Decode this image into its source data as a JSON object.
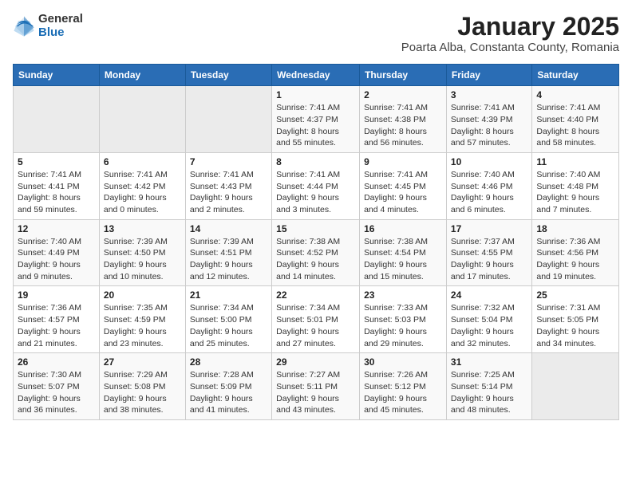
{
  "logo": {
    "general": "General",
    "blue": "Blue"
  },
  "title": "January 2025",
  "subtitle": "Poarta Alba, Constanta County, Romania",
  "headers": [
    "Sunday",
    "Monday",
    "Tuesday",
    "Wednesday",
    "Thursday",
    "Friday",
    "Saturday"
  ],
  "weeks": [
    [
      {
        "day": "",
        "sunrise": "",
        "sunset": "",
        "daylight": ""
      },
      {
        "day": "",
        "sunrise": "",
        "sunset": "",
        "daylight": ""
      },
      {
        "day": "",
        "sunrise": "",
        "sunset": "",
        "daylight": ""
      },
      {
        "day": "1",
        "sunrise": "Sunrise: 7:41 AM",
        "sunset": "Sunset: 4:37 PM",
        "daylight": "Daylight: 8 hours and 55 minutes."
      },
      {
        "day": "2",
        "sunrise": "Sunrise: 7:41 AM",
        "sunset": "Sunset: 4:38 PM",
        "daylight": "Daylight: 8 hours and 56 minutes."
      },
      {
        "day": "3",
        "sunrise": "Sunrise: 7:41 AM",
        "sunset": "Sunset: 4:39 PM",
        "daylight": "Daylight: 8 hours and 57 minutes."
      },
      {
        "day": "4",
        "sunrise": "Sunrise: 7:41 AM",
        "sunset": "Sunset: 4:40 PM",
        "daylight": "Daylight: 8 hours and 58 minutes."
      }
    ],
    [
      {
        "day": "5",
        "sunrise": "Sunrise: 7:41 AM",
        "sunset": "Sunset: 4:41 PM",
        "daylight": "Daylight: 8 hours and 59 minutes."
      },
      {
        "day": "6",
        "sunrise": "Sunrise: 7:41 AM",
        "sunset": "Sunset: 4:42 PM",
        "daylight": "Daylight: 9 hours and 0 minutes."
      },
      {
        "day": "7",
        "sunrise": "Sunrise: 7:41 AM",
        "sunset": "Sunset: 4:43 PM",
        "daylight": "Daylight: 9 hours and 2 minutes."
      },
      {
        "day": "8",
        "sunrise": "Sunrise: 7:41 AM",
        "sunset": "Sunset: 4:44 PM",
        "daylight": "Daylight: 9 hours and 3 minutes."
      },
      {
        "day": "9",
        "sunrise": "Sunrise: 7:41 AM",
        "sunset": "Sunset: 4:45 PM",
        "daylight": "Daylight: 9 hours and 4 minutes."
      },
      {
        "day": "10",
        "sunrise": "Sunrise: 7:40 AM",
        "sunset": "Sunset: 4:46 PM",
        "daylight": "Daylight: 9 hours and 6 minutes."
      },
      {
        "day": "11",
        "sunrise": "Sunrise: 7:40 AM",
        "sunset": "Sunset: 4:48 PM",
        "daylight": "Daylight: 9 hours and 7 minutes."
      }
    ],
    [
      {
        "day": "12",
        "sunrise": "Sunrise: 7:40 AM",
        "sunset": "Sunset: 4:49 PM",
        "daylight": "Daylight: 9 hours and 9 minutes."
      },
      {
        "day": "13",
        "sunrise": "Sunrise: 7:39 AM",
        "sunset": "Sunset: 4:50 PM",
        "daylight": "Daylight: 9 hours and 10 minutes."
      },
      {
        "day": "14",
        "sunrise": "Sunrise: 7:39 AM",
        "sunset": "Sunset: 4:51 PM",
        "daylight": "Daylight: 9 hours and 12 minutes."
      },
      {
        "day": "15",
        "sunrise": "Sunrise: 7:38 AM",
        "sunset": "Sunset: 4:52 PM",
        "daylight": "Daylight: 9 hours and 14 minutes."
      },
      {
        "day": "16",
        "sunrise": "Sunrise: 7:38 AM",
        "sunset": "Sunset: 4:54 PM",
        "daylight": "Daylight: 9 hours and 15 minutes."
      },
      {
        "day": "17",
        "sunrise": "Sunrise: 7:37 AM",
        "sunset": "Sunset: 4:55 PM",
        "daylight": "Daylight: 9 hours and 17 minutes."
      },
      {
        "day": "18",
        "sunrise": "Sunrise: 7:36 AM",
        "sunset": "Sunset: 4:56 PM",
        "daylight": "Daylight: 9 hours and 19 minutes."
      }
    ],
    [
      {
        "day": "19",
        "sunrise": "Sunrise: 7:36 AM",
        "sunset": "Sunset: 4:57 PM",
        "daylight": "Daylight: 9 hours and 21 minutes."
      },
      {
        "day": "20",
        "sunrise": "Sunrise: 7:35 AM",
        "sunset": "Sunset: 4:59 PM",
        "daylight": "Daylight: 9 hours and 23 minutes."
      },
      {
        "day": "21",
        "sunrise": "Sunrise: 7:34 AM",
        "sunset": "Sunset: 5:00 PM",
        "daylight": "Daylight: 9 hours and 25 minutes."
      },
      {
        "day": "22",
        "sunrise": "Sunrise: 7:34 AM",
        "sunset": "Sunset: 5:01 PM",
        "daylight": "Daylight: 9 hours and 27 minutes."
      },
      {
        "day": "23",
        "sunrise": "Sunrise: 7:33 AM",
        "sunset": "Sunset: 5:03 PM",
        "daylight": "Daylight: 9 hours and 29 minutes."
      },
      {
        "day": "24",
        "sunrise": "Sunrise: 7:32 AM",
        "sunset": "Sunset: 5:04 PM",
        "daylight": "Daylight: 9 hours and 32 minutes."
      },
      {
        "day": "25",
        "sunrise": "Sunrise: 7:31 AM",
        "sunset": "Sunset: 5:05 PM",
        "daylight": "Daylight: 9 hours and 34 minutes."
      }
    ],
    [
      {
        "day": "26",
        "sunrise": "Sunrise: 7:30 AM",
        "sunset": "Sunset: 5:07 PM",
        "daylight": "Daylight: 9 hours and 36 minutes."
      },
      {
        "day": "27",
        "sunrise": "Sunrise: 7:29 AM",
        "sunset": "Sunset: 5:08 PM",
        "daylight": "Daylight: 9 hours and 38 minutes."
      },
      {
        "day": "28",
        "sunrise": "Sunrise: 7:28 AM",
        "sunset": "Sunset: 5:09 PM",
        "daylight": "Daylight: 9 hours and 41 minutes."
      },
      {
        "day": "29",
        "sunrise": "Sunrise: 7:27 AM",
        "sunset": "Sunset: 5:11 PM",
        "daylight": "Daylight: 9 hours and 43 minutes."
      },
      {
        "day": "30",
        "sunrise": "Sunrise: 7:26 AM",
        "sunset": "Sunset: 5:12 PM",
        "daylight": "Daylight: 9 hours and 45 minutes."
      },
      {
        "day": "31",
        "sunrise": "Sunrise: 7:25 AM",
        "sunset": "Sunset: 5:14 PM",
        "daylight": "Daylight: 9 hours and 48 minutes."
      },
      {
        "day": "",
        "sunrise": "",
        "sunset": "",
        "daylight": ""
      }
    ]
  ]
}
